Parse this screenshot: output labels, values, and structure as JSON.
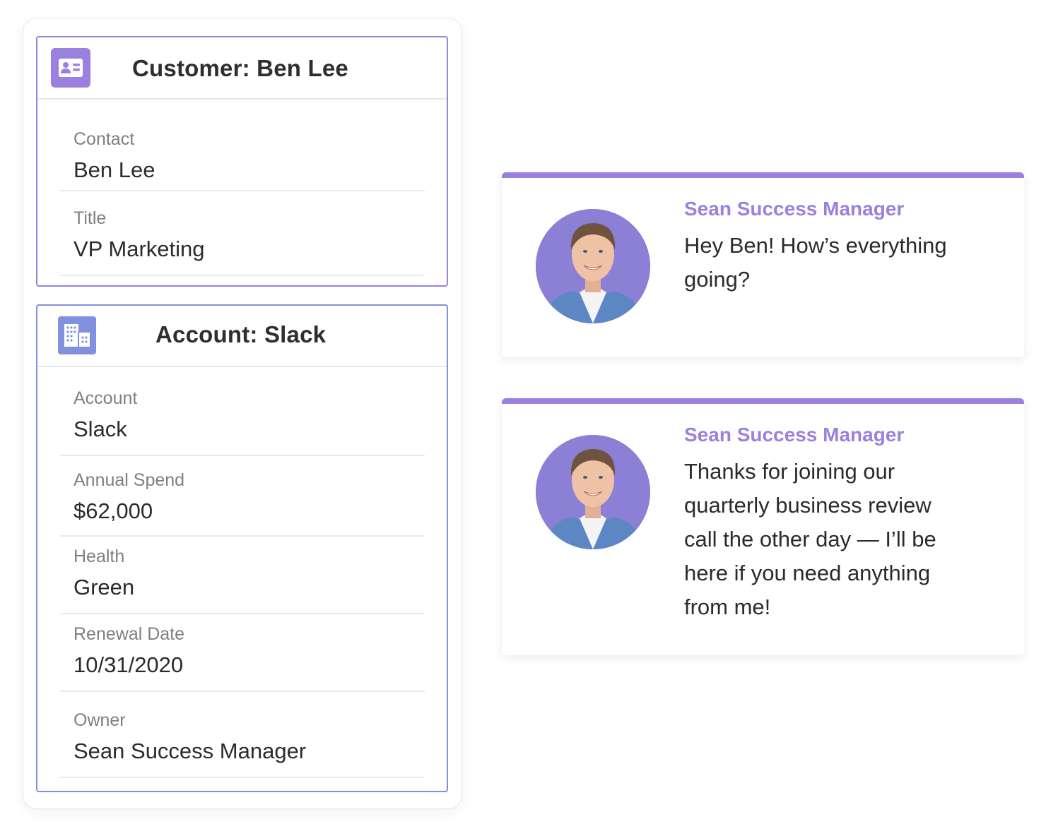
{
  "colors": {
    "accent_purple": "#9b80e0",
    "accent_periwinkle": "#8191e0",
    "divider": "#e6e9ee",
    "label_gray": "#7f7f7f",
    "text_dark": "#2b2b2b"
  },
  "customer_card": {
    "icon": "contact-card-icon",
    "title": "Customer: Ben Lee",
    "fields": [
      {
        "label": "Contact",
        "value": "Ben Lee"
      },
      {
        "label": "Title",
        "value": "VP Marketing"
      }
    ]
  },
  "account_card": {
    "icon": "building-icon",
    "title": "Account: Slack",
    "fields": [
      {
        "label": "Account",
        "value": "Slack"
      },
      {
        "label": "Annual Spend",
        "value": "$62,000"
      },
      {
        "label": "Health",
        "value": "Green"
      },
      {
        "label": "Renewal Date",
        "value": "10/31/2020"
      },
      {
        "label": "Owner",
        "value": "Sean Success Manager"
      }
    ]
  },
  "messages": [
    {
      "sender": "Sean Success Manager",
      "avatar": "avatar-photo",
      "text": "Hey Ben! How’s everything going?"
    },
    {
      "sender": "Sean Success Manager",
      "avatar": "avatar-photo",
      "text": "Thanks for joining our quarterly business review call the other day — I’ll be here if you need anything from me!"
    }
  ]
}
